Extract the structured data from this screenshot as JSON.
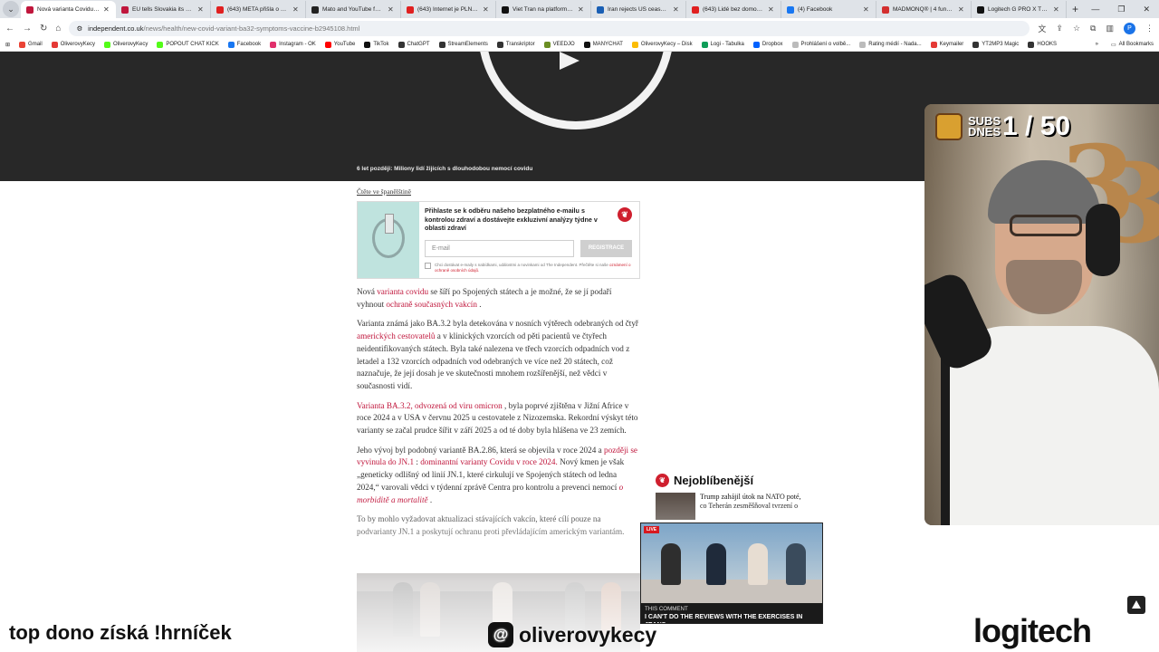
{
  "browser": {
    "tabs": [
      {
        "title": "Nová varianta Covidu by se",
        "color": "#c0163c",
        "active": true
      },
      {
        "title": "EU tells Slovakia its plan t",
        "color": "#c0163c"
      },
      {
        "title": "(643) META přišla o 70 00",
        "color": "#e02020"
      },
      {
        "title": "Mato and YouTube found",
        "color": "#222222"
      },
      {
        "title": "(643) Internet je PLNÝ ÚČ",
        "color": "#e02020"
      },
      {
        "title": "Viet Tran na platformě X:",
        "color": "#111111"
      },
      {
        "title": "Iran rejects US ceasefire p",
        "color": "#1a5fb4"
      },
      {
        "title": "(643) Lidé bez domova v",
        "color": "#e02020"
      },
      {
        "title": "(4) Facebook",
        "color": "#1877f2"
      },
      {
        "title": "MADMONQ® | 4 funkční",
        "color": "#d32f2f"
      },
      {
        "title": "Logitech G PRO X TKL LIG",
        "color": "#111111"
      }
    ],
    "new_tab": "+",
    "url_domain": "independent.co.uk",
    "url_path": "/news/health/new-covid-variant-ba32-symptoms-vaccine-b2945108.html",
    "profile_initial": "P",
    "bookmarks": [
      {
        "label": "Gmail",
        "color": "#ea4335"
      },
      {
        "label": "OliverovyKecy",
        "color": "#e53935"
      },
      {
        "label": "OliverovyKecy",
        "color": "#53fc18"
      },
      {
        "label": "POPOUT CHAT KICK",
        "color": "#53fc18"
      },
      {
        "label": "Facebook",
        "color": "#1877f2"
      },
      {
        "label": "Instagram - OK",
        "color": "#e1306c"
      },
      {
        "label": "YouTube",
        "color": "#ff0000"
      },
      {
        "label": "TikTok",
        "color": "#111111"
      },
      {
        "label": "ChatGPT",
        "color": "#333333"
      },
      {
        "label": "StreamElements",
        "color": "#333333"
      },
      {
        "label": "Transkriptor",
        "color": "#333333"
      },
      {
        "label": "VEEDJO",
        "color": "#6b8e23"
      },
      {
        "label": "MANYCHAT",
        "color": "#111111"
      },
      {
        "label": "OliverovyKecy – Disk",
        "color": "#fbbc04"
      },
      {
        "label": "Logi - Tabulka",
        "color": "#0f9d58"
      },
      {
        "label": "Dropbox",
        "color": "#0061fe"
      },
      {
        "label": "Prohlášení o volbě...",
        "color": "#bbbbbb"
      },
      {
        "label": "Rating médií - Nada...",
        "color": "#bbbbbb"
      },
      {
        "label": "Keymailer",
        "color": "#e53935"
      },
      {
        "label": "YT2MP3 Magic",
        "color": "#333333"
      },
      {
        "label": "HOOKS",
        "color": "#333333"
      }
    ],
    "all_bookmarks": "All Bookmarks"
  },
  "video": {
    "caption": "6 let později: Miliony lidí žijících s dlouhodobou nemocí covidu"
  },
  "article": {
    "read_in_spanish": "Čtěte ve španělštině",
    "newsletter": {
      "title": "Přihlaste se k odběru našeho bezplatného e-mailu s kontrolou zdraví a dostávejte exkluzivní analýzy týdne v oblasti zdraví",
      "email_placeholder": "E-mail",
      "button": "REGISTRACE",
      "consent": "Chci dostávat e-maily s nabídkami, událostmi a novinkami od The Independent. Přečtěte si naše",
      "consent_link": "oznámení o ochraně osobních údajů."
    },
    "p1": {
      "a": "Nová ",
      "b": "varianta covidu",
      "c": " se šíří po Spojených státech a je možné, že se jí podaří vyhnout ",
      "d": "ochraně současných vakcín",
      "e": " ."
    },
    "p2": {
      "a": "Varianta známá jako BA.3.2 byla detekována v nosních výtěrech odebraných od čtyř ",
      "b": "amerických cestovatelů",
      "c": " a v klinických vzorcích od pěti pacientů ve čtyřech neidentifikovaných státech. Byla také nalezena ve třech vzorcích odpadních vod z letadel a 132 vzorcích odpadních vod odebraných ve více než 20 státech, což naznačuje, že její dosah je ve skutečnosti mnohem rozšířenější, než vědci v současnosti vidí."
    },
    "p3": {
      "a": "Varianta BA.3.2, odvozená od viru omicron",
      "b": " , byla poprvé zjištěna v Jižní Africe v roce 2024 a v USA v červnu 2025 u cestovatele z Nizozemska. Rekordní výskyt této varianty se začal prudce šířit v září 2025 a od té doby byla hlášena ve 23 zemích."
    },
    "p4": {
      "a": "Jeho vývoj byl podobný variantě BA.2.86, která se objevila v roce 2024 a ",
      "b": "později se vyvinula do JN.1",
      "c": " : ",
      "d": "dominantní varianty Covidu v roce 2024.",
      "e": " Nový kmen je však „geneticky odlišný od linií JN.1, které cirkulují ve Spojených státech od ledna 2024,“ varovali vědci v týdenní zprávě Centra pro kontrolu a prevenci nemocí ",
      "f": "o morbiditě a mortalitě",
      "g": " ."
    },
    "p5": "To by mohlo vyžadovat aktualizaci stávajících vakcín, které cílí pouze na podvarianty JN.1 a poskytují ochranu proti převládajícím americkým variantám."
  },
  "popular": {
    "heading": "Nejoblíbenější",
    "item1": "Trump zahájil útok na NATO poté, co Teherán zesměšňoval tvrzení o"
  },
  "overlays": {
    "subs_label": "SUBS DNES",
    "subs_count": "1 / 50",
    "tv_live": "LIVE",
    "tv_line1": "THIS COMMENT",
    "tv_line2": "I CAN'T DO THE REVIEWS WITH THE EXERCISES IN JEANS",
    "bottom_left": "top dono získá !hrníček",
    "threads_handle": "oliverovykecy",
    "brand": "logitech"
  }
}
